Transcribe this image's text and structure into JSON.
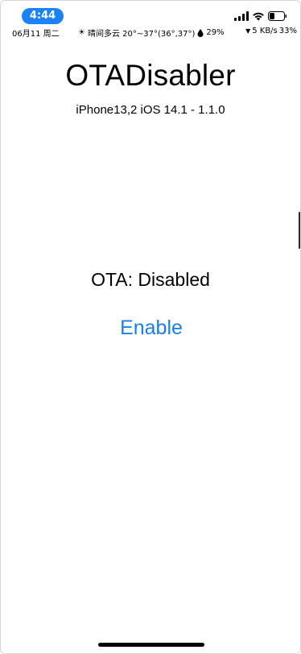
{
  "status_bar": {
    "time": "4:44",
    "date": "06月11 周二",
    "weather": "晴间多云 20°~37°(36°,37°)",
    "humidity": "29%",
    "network": "5 KB/s",
    "battery_percent": "33%",
    "icons": [
      "signal-icon",
      "wifi-icon",
      "battery-icon",
      "sun-icon",
      "drop-icon",
      "down-arrow-icon"
    ],
    "accent_color": "#1a82f6"
  },
  "app": {
    "title": "OTADisabler",
    "device_info": "iPhone13,2 iOS 14.1 - 1.1.0",
    "ota_status": "OTA: Disabled",
    "enable_label": "Enable",
    "link_color": "#1a7fe4"
  }
}
